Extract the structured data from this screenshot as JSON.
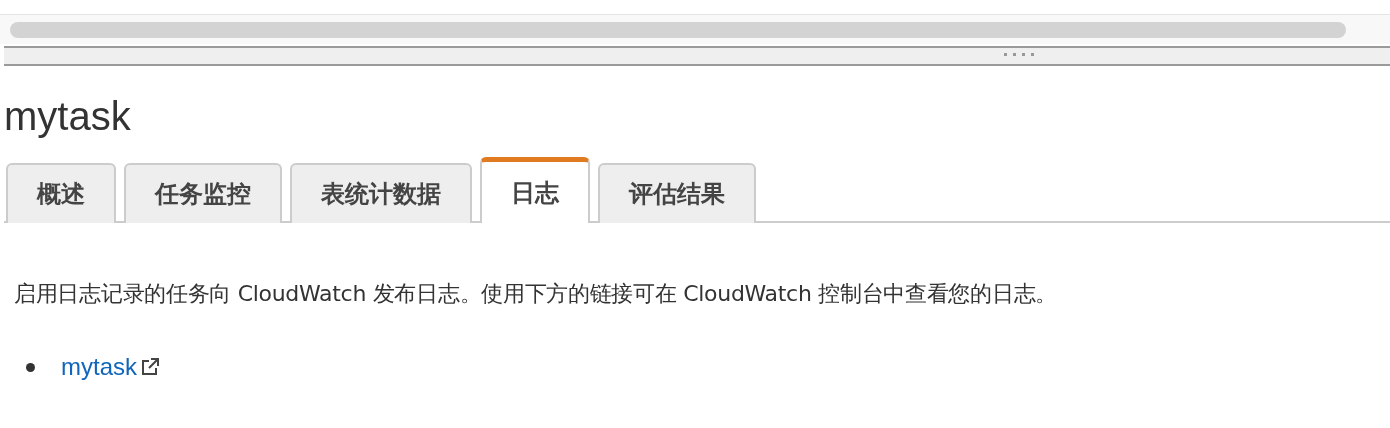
{
  "title": "mytask",
  "tabs": [
    {
      "label": "概述",
      "selected": false
    },
    {
      "label": "任务监控",
      "selected": false
    },
    {
      "label": "表统计数据",
      "selected": false
    },
    {
      "label": "日志",
      "selected": true
    },
    {
      "label": "评估结果",
      "selected": false
    }
  ],
  "description": "启用日志记录的任务向 CloudWatch 发布日志。使用下方的链接可在 CloudWatch 控制台中查看您的日志。",
  "links": [
    {
      "label": "mytask"
    }
  ]
}
